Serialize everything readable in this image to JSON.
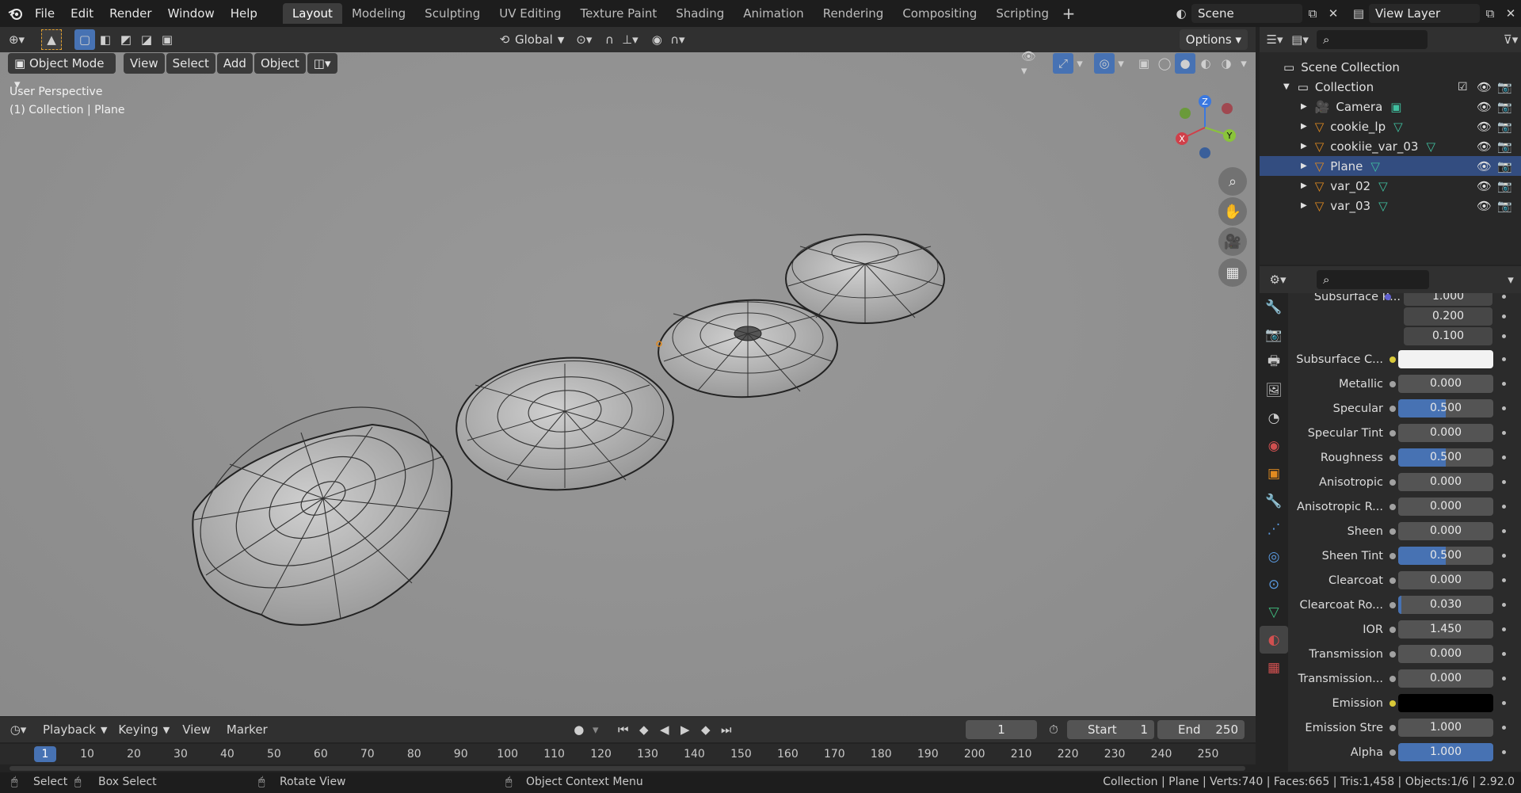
{
  "topbar": {
    "menus": [
      "File",
      "Edit",
      "Render",
      "Window",
      "Help"
    ],
    "workspaces": [
      "Layout",
      "Modeling",
      "Sculpting",
      "UV Editing",
      "Texture Paint",
      "Shading",
      "Animation",
      "Rendering",
      "Compositing",
      "Scripting"
    ],
    "active_workspace": "Layout",
    "scene": "Scene",
    "view_layer": "View Layer"
  },
  "toolheader": {
    "transform_orientation": "Global",
    "options": "Options"
  },
  "viewport_header": {
    "mode": "Object Mode",
    "menus": [
      "View",
      "Select",
      "Add",
      "Object"
    ]
  },
  "viewport": {
    "perspective": "User Perspective",
    "collection_info": "(1) Collection | Plane",
    "gizmo": {
      "x": "X",
      "y": "Y",
      "z": "Z"
    }
  },
  "outliner": {
    "root": "Scene Collection",
    "collection": "Collection",
    "items": [
      {
        "name": "Camera",
        "type": "camera",
        "selected": false
      },
      {
        "name": "cookie_lp",
        "type": "mesh",
        "selected": false
      },
      {
        "name": "cookiie_var_03",
        "type": "mesh",
        "selected": false
      },
      {
        "name": "Plane",
        "type": "mesh",
        "selected": true
      },
      {
        "name": "var_02",
        "type": "mesh",
        "selected": false
      },
      {
        "name": "var_03",
        "type": "mesh",
        "selected": false
      }
    ]
  },
  "properties": {
    "partial_label": "Subsurface R...",
    "subsurface_radius": [
      "1.000",
      "0.200",
      "0.100"
    ],
    "rows": [
      {
        "label": "Subsurface C...",
        "value": "",
        "kind": "color",
        "color": "#f2f2f2",
        "dot": "#d8c838"
      },
      {
        "label": "Metallic",
        "value": "0.000",
        "fill": 0
      },
      {
        "label": "Specular",
        "value": "0.500",
        "fill": 0.5
      },
      {
        "label": "Specular Tint",
        "value": "0.000",
        "fill": 0
      },
      {
        "label": "Roughness",
        "value": "0.500",
        "fill": 0.5
      },
      {
        "label": "Anisotropic",
        "value": "0.000",
        "fill": 0
      },
      {
        "label": "Anisotropic R...",
        "value": "0.000",
        "fill": 0
      },
      {
        "label": "Sheen",
        "value": "0.000",
        "fill": 0
      },
      {
        "label": "Sheen Tint",
        "value": "0.500",
        "fill": 0.5
      },
      {
        "label": "Clearcoat",
        "value": "0.000",
        "fill": 0
      },
      {
        "label": "Clearcoat Ro...",
        "value": "0.030",
        "fill": 0.03
      },
      {
        "label": "IOR",
        "value": "1.450",
        "fill": 0
      },
      {
        "label": "Transmission",
        "value": "0.000",
        "fill": 0
      },
      {
        "label": "Transmission...",
        "value": "0.000",
        "fill": 0
      },
      {
        "label": "Emission",
        "value": "",
        "kind": "color",
        "color": "#000000",
        "dot": "#d8c838"
      },
      {
        "label": "Emission Stre",
        "value": "1.000",
        "fill": 0
      },
      {
        "label": "Alpha",
        "value": "1.000",
        "fill": 1
      }
    ]
  },
  "timeline": {
    "menus": [
      "Playback",
      "Keying",
      "View",
      "Marker"
    ],
    "current_frame": "1",
    "start_label": "Start",
    "start": "1",
    "end_label": "End",
    "end": "250",
    "ruler": [
      "1",
      "10",
      "20",
      "30",
      "40",
      "50",
      "60",
      "70",
      "80",
      "90",
      "100",
      "110",
      "120",
      "130",
      "140",
      "150",
      "160",
      "170",
      "180",
      "190",
      "200",
      "210",
      "220",
      "230",
      "240",
      "250"
    ]
  },
  "statusbar": {
    "select": "Select",
    "box_select": "Box Select",
    "rotate": "Rotate View",
    "context": "Object Context Menu",
    "stats": "Collection | Plane | Verts:740 | Faces:665 | Tris:1,458 | Objects:1/6 | 2.92.0"
  },
  "colors": {
    "accent": "#4772b3",
    "selection": "#334d80",
    "viewport_bg": "#8e8e8e"
  }
}
